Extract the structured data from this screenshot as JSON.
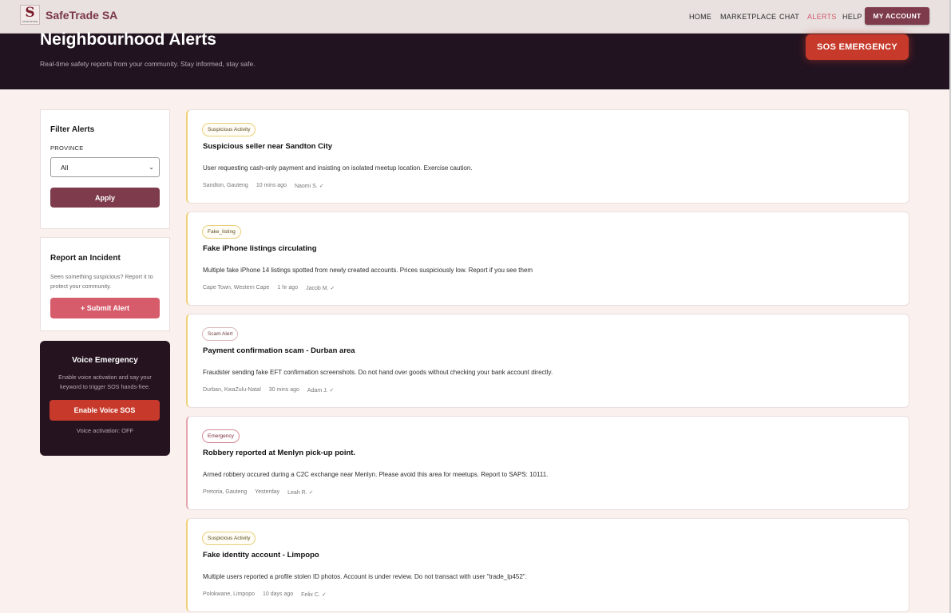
{
  "app": {
    "brand": "SafeTrade SA",
    "logo_letter": "S",
    "logo_tagline": "SAFETRADE"
  },
  "nav": {
    "items": [
      {
        "label": "HOME"
      },
      {
        "label": "MARKETPLACE"
      },
      {
        "label": "CHAT"
      },
      {
        "label": "ALERTS",
        "active": true
      },
      {
        "label": "HELP"
      }
    ],
    "account_button": "MY ACCOUNT"
  },
  "hero": {
    "title": "Neighbourhood Alerts",
    "subtitle": "Real-time safety reports from your community. Stay informed, stay safe.",
    "sos_button": "SOS EMERGENCY"
  },
  "filter": {
    "title": "Filter Alerts",
    "province_label": "PROVINCE",
    "province_value": "All",
    "apply_button": "Apply"
  },
  "report": {
    "title": "Report an Incident",
    "description": "Seen something suspicious? Report it to protect your community.",
    "submit_button": "+ Submit Alert"
  },
  "voice": {
    "title": "Voice Emergency",
    "description": "Enable voice activation and say your keyword to trigger SOS hands-free.",
    "button": "Enable Voice SOS",
    "status": "Voice activation: OFF"
  },
  "alerts": [
    {
      "category": "Suspicious Activity",
      "title": "Suspicious seller near Sandton City",
      "description": "User requesting cash-only payment and insisting on isolated meetup location. Exercise caution.",
      "location": "Sandton, Gauteng",
      "time": "10 mins ago",
      "author": "Naomi S. ✓"
    },
    {
      "category": "Fake_listing",
      "title": "Fake iPhone listings circulating",
      "description": "Multiple fake iPhone 14 listings spotted from newly created accounts. Prices suspiciously low. Report if you see them",
      "location": "Cape Town, Western Cape",
      "time": "1 hr ago",
      "author": "Jacob M. ✓"
    },
    {
      "category": "Scam Alert",
      "title": "Payment confirmation scam - Durban area",
      "description": "Fraudster sending fake EFT confirmation screenshots. Do not hand over goods without checking your bank account directly.",
      "location": "Durban, KwaZulu-Natal",
      "time": "30 mins ago",
      "author": "Adam J. ✓"
    },
    {
      "category": "Emergency",
      "title": "Robbery reported at Menlyn pick-up point.",
      "description": "Armed robbery occured during a C2C exchange near Menlyn. Please avoid this area for meetups. Report to SAPS: 10111.",
      "location": "Pretoria, Gauteng",
      "time": "Yesterday",
      "author": "Leah R. ✓"
    },
    {
      "category": "Suspicious Activity",
      "title": "Fake identity account - Limpopo",
      "description": "Multiple users reported a profile stolen ID photos. Account is under review. Do not transact with user \"trade_lp452\".",
      "location": "Polokwane, Limpopo",
      "time": "10 days ago",
      "author": "Felix C. ✓"
    }
  ],
  "colors": {
    "brand": "#7e3b4c",
    "hero_bg": "#221321",
    "sos": "#c73a2b",
    "page_bg": "#faf0ee",
    "nav_active": "#d05a6a"
  }
}
